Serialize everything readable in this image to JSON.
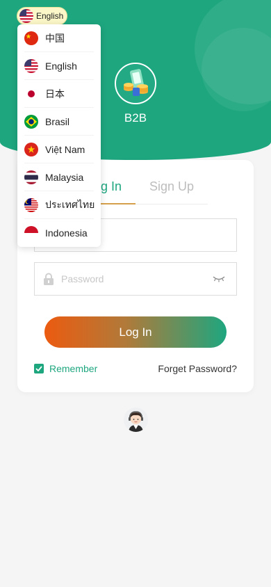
{
  "brand": {
    "name": "B2B"
  },
  "tabs": {
    "login": "Log In",
    "signup": "Sign Up"
  },
  "form": {
    "username_placeholder": "",
    "password_placeholder": "Password",
    "login_button": "Log In",
    "remember_label": "Remember",
    "remember_checked": true,
    "forget_label": "Forget Password?"
  },
  "language": {
    "current": "English",
    "current_flag": "flag-us-icon",
    "options": [
      {
        "label": "中国",
        "flag": "flag-cn-icon"
      },
      {
        "label": "English",
        "flag": "flag-us-icon"
      },
      {
        "label": "日本",
        "flag": "flag-jp-icon"
      },
      {
        "label": "Brasil",
        "flag": "flag-br-icon"
      },
      {
        "label": "Việt Nam",
        "flag": "flag-vn-icon"
      },
      {
        "label": "Malaysia",
        "flag": "flag-my-icon"
      },
      {
        "label": "ประเทศไทย",
        "flag": "flag-th-icon"
      },
      {
        "label": "Indonesia",
        "flag": "flag-id-icon"
      }
    ]
  },
  "colors": {
    "primary": "#1ea67f",
    "accent_orange": "#ec5b10",
    "tab_underline": "#d6a04a",
    "pill_bg": "#fbf7c8"
  }
}
